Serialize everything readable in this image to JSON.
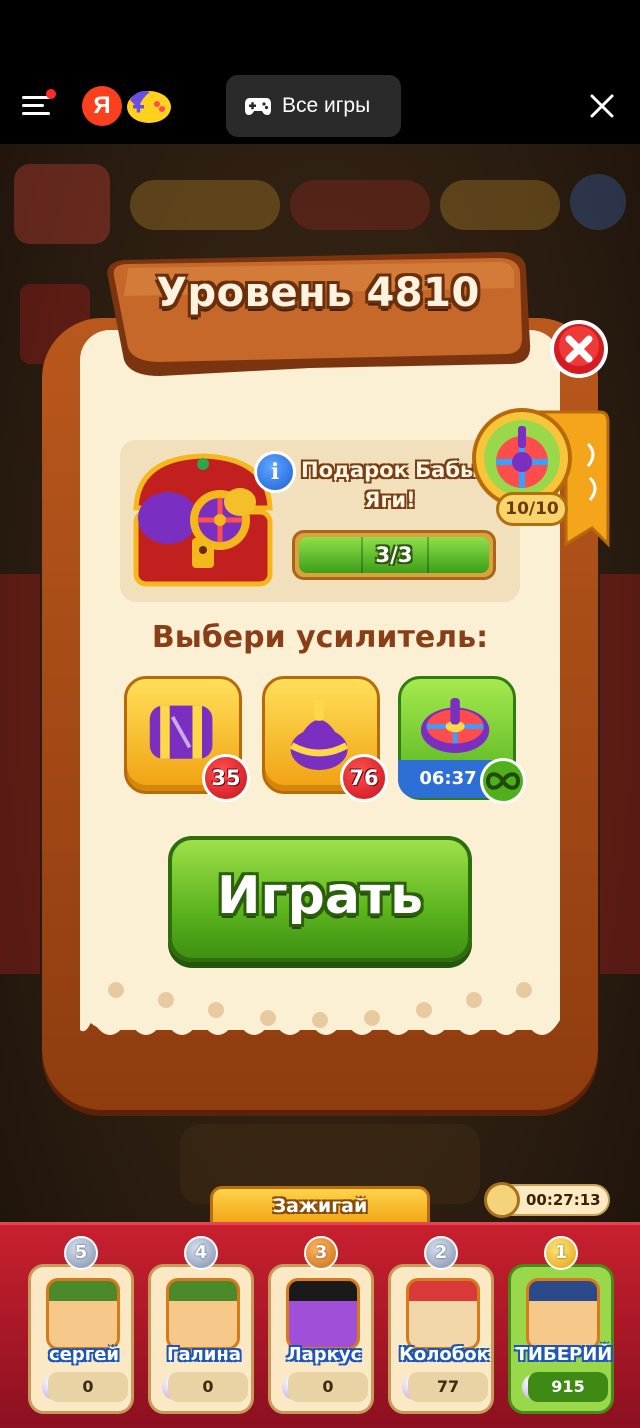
{
  "platform_bar": {
    "all_games_label": "Все игры",
    "logo_letter": "Я",
    "icons": [
      "menu-icon",
      "yandex-logo",
      "yandex-games-logo",
      "gamepad-icon",
      "close-icon"
    ],
    "accent": "#fc3f1d"
  },
  "modal": {
    "title": "Уровень 4810",
    "gift": {
      "title": "Подарок Бабы Яги!",
      "progress_text": "3/3",
      "progress_fraction": 1.0,
      "flag_count": "10/10"
    },
    "choose_title": "Выбери усилитель:",
    "boosters": [
      {
        "icon": "hammer-booster-icon",
        "count": "35"
      },
      {
        "icon": "spinning-top-booster-icon",
        "count": "76"
      },
      {
        "icon": "roulette-booster-icon",
        "timer": "06:37",
        "count_icon": "infinity-icon"
      }
    ],
    "play_label": "Играть"
  },
  "leaderboard": {
    "tab_label": "Зажигай",
    "timer": "00:27:13",
    "players": [
      {
        "rank": "5",
        "name": "сергей",
        "score": "0"
      },
      {
        "rank": "4",
        "name": "Галина",
        "score": "0"
      },
      {
        "rank": "3",
        "name": "Ларкус",
        "score": "0"
      },
      {
        "rank": "2",
        "name": "Колобок",
        "score": "77"
      },
      {
        "rank": "1",
        "name": "ТИБЕРИЙ",
        "score": "915"
      }
    ]
  },
  "colors": {
    "modal_wood": "#b9581d",
    "modal_paper": "#fbf0d4",
    "play_green": "#5cb41e",
    "leaderboard_red": "#c8202f"
  }
}
